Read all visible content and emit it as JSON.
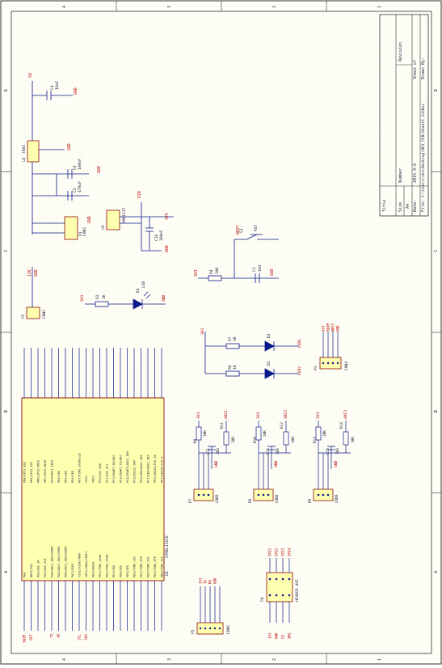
{
  "sheet": {
    "zones_top": [
      "4",
      "3",
      "2",
      "1"
    ],
    "zones_side": [
      "D",
      "C",
      "B",
      "A"
    ],
    "colors": {
      "paper": "#fffef6",
      "grid": "#e7e5d6",
      "wire": "#0a1a8c",
      "net": "#b00000",
      "body": "#ffffb0",
      "pin": "#8a0a0a",
      "text": "#1a1a3a"
    }
  },
  "title_block": {
    "title": "Title",
    "size": "Size",
    "size_value": "A4",
    "number": "Number",
    "revision": "Revision",
    "date": "Date:",
    "date_value": "2015-4-6",
    "sheet": "Sheet  of",
    "file": "File:",
    "file_value": "C:\\Users\\zhu\\Desktop\\MCU_PCB\\Sheet1.SchDoc",
    "drawn": "Drawn By:"
  },
  "mcu": {
    "designator": "U1",
    "part": "STM8L151C8",
    "left_pins": [
      "PE7/SEG25/LCD_a",
      "PE6/SEG24/PVD_IN",
      "PC7/SEG/ADC1_IN3",
      "PC6/SEG/ADC1_IN4",
      "PC5/OSC32_OUT",
      "PC4/USART/ADC1_IN4",
      "PC3/USART_TX/ADC",
      "PC2/USART_RX/ADC",
      "PC1/I2C_SCL",
      "PC0/I2C_SDA",
      "VDD2",
      "VSS2",
      "PD7/TIM1_CH1N/LCD",
      "PD6/SEG",
      "PD5/SEG",
      "PD4/SEG",
      "PF0/ADC1_IN24",
      "PB7/SPI1_MISO",
      "PB6/SPI1_MOSI",
      "PB5/SPI1_SCK",
      "PB4/SPI1_NSS"
    ],
    "right_pins": [
      "PA0",
      "NRST/PA1",
      "PA2/OSC_IN",
      "PA3/OSC_OUT",
      "PA4/ADC1_IN2/COMP1",
      "PA5/ADC1_IN1/COMP1",
      "PA6/ADC1_IN0/COMP1",
      "PA7/SEG5",
      "VSS1/VSSA/VREF-",
      "VDD1/VDDA/VREF+",
      "PE0/SEG23",
      "PE1/TIM1_CH2N",
      "PE2/TIM1_CH3N",
      "PE3/SEG",
      "PE4/SEG",
      "PE5/SEG",
      "PD0/TIM3_CH2",
      "PD1/TIM3_ETR",
      "PD2/TIM1_CH1",
      "PD3/TIM1_ETR",
      "PB0/TIM2_CH1"
    ],
    "right_nets": [
      "SWIM",
      "NRST",
      "",
      "",
      "",
      "",
      "",
      "",
      "GND",
      "3V3",
      "",
      "",
      "",
      "",
      "",
      "",
      "",
      "",
      "",
      "",
      ""
    ]
  },
  "power": {
    "c4": {
      "designator": "C4",
      "value": "10uF"
    },
    "u2": {
      "designator": "U2",
      "part": "7805"
    },
    "c6": {
      "designator": "C6",
      "value": "100nF"
    },
    "c5": {
      "designator": "C5",
      "value": "470uF"
    },
    "p1": {
      "designator": "P1",
      "part": "CON2"
    },
    "u3": {
      "designator": "U3",
      "part": "AMS1117"
    },
    "c10": {
      "designator": "C10",
      "value": "100nF"
    },
    "p2": {
      "designator": "P2",
      "part": "CON2"
    },
    "nets": {
      "v12": "12V",
      "v5": "5V",
      "v33": "3V3",
      "gnd": "GND",
      "vin": "VIN"
    }
  },
  "reset": {
    "s1": "S1",
    "label": "RST",
    "r4": "R4",
    "r4v": "10K",
    "c1": "C1",
    "c1v": "104",
    "net": "NRST",
    "vcc": "3V3",
    "gnd": "GND"
  },
  "power_led": {
    "r3": "R3",
    "r3v": "1K",
    "d1": "D1",
    "d1l": "LED",
    "vcc": "3V3",
    "gnd": "GND"
  },
  "leds": [
    {
      "r": "R7",
      "rv": "1K",
      "d": "D3",
      "net": "LED1"
    },
    {
      "r": "R8",
      "rv": "1K",
      "d": "D2",
      "net": "LED2"
    }
  ],
  "leds_vcc": "3V3",
  "p3": {
    "designator": "P3",
    "part": "CON4",
    "nets": [
      "3V3",
      "SWIM",
      "NRST",
      "GND"
    ]
  },
  "sensors": [
    {
      "r_pull": "R9",
      "r_pull_v": "10K",
      "r": "R11",
      "rv": "100",
      "c": "C11",
      "cv": "104",
      "j": "P7",
      "part": "CON3",
      "net": "ADC1"
    },
    {
      "r_pull": "R10",
      "r_pull_v": "10K",
      "r": "R12",
      "rv": "100",
      "c": "C12",
      "cv": "104",
      "j": "P8",
      "part": "CON3",
      "net": "ADC2"
    },
    {
      "r_pull": "R13",
      "r_pull_v": "10K",
      "r": "R14",
      "rv": "100",
      "c": "C13",
      "cv": "104",
      "j": "P9",
      "part": "CON3",
      "net": "ADC3"
    }
  ],
  "sensor_vcc": "3V3",
  "sensor_gnd": "GND",
  "p5": {
    "designator": "P5",
    "part": "CON5",
    "nets": [
      "3V3",
      "TX",
      "RX",
      "GND",
      ""
    ]
  },
  "p4": {
    "designator": "P4",
    "part": "HEADER 4X2",
    "top": [
      "SPI1",
      "SPI2",
      "SPI3",
      "SPI4"
    ],
    "bottom": [
      "3V3",
      "GND",
      "CE",
      "IRQ"
    ]
  },
  "bottom_nets": [
    "SWIM",
    "RST",
    "",
    "",
    "TX",
    "RX",
    "",
    "",
    "SCL",
    "SDA",
    "",
    "",
    "",
    "",
    "",
    "",
    "",
    "",
    "",
    "",
    ""
  ]
}
